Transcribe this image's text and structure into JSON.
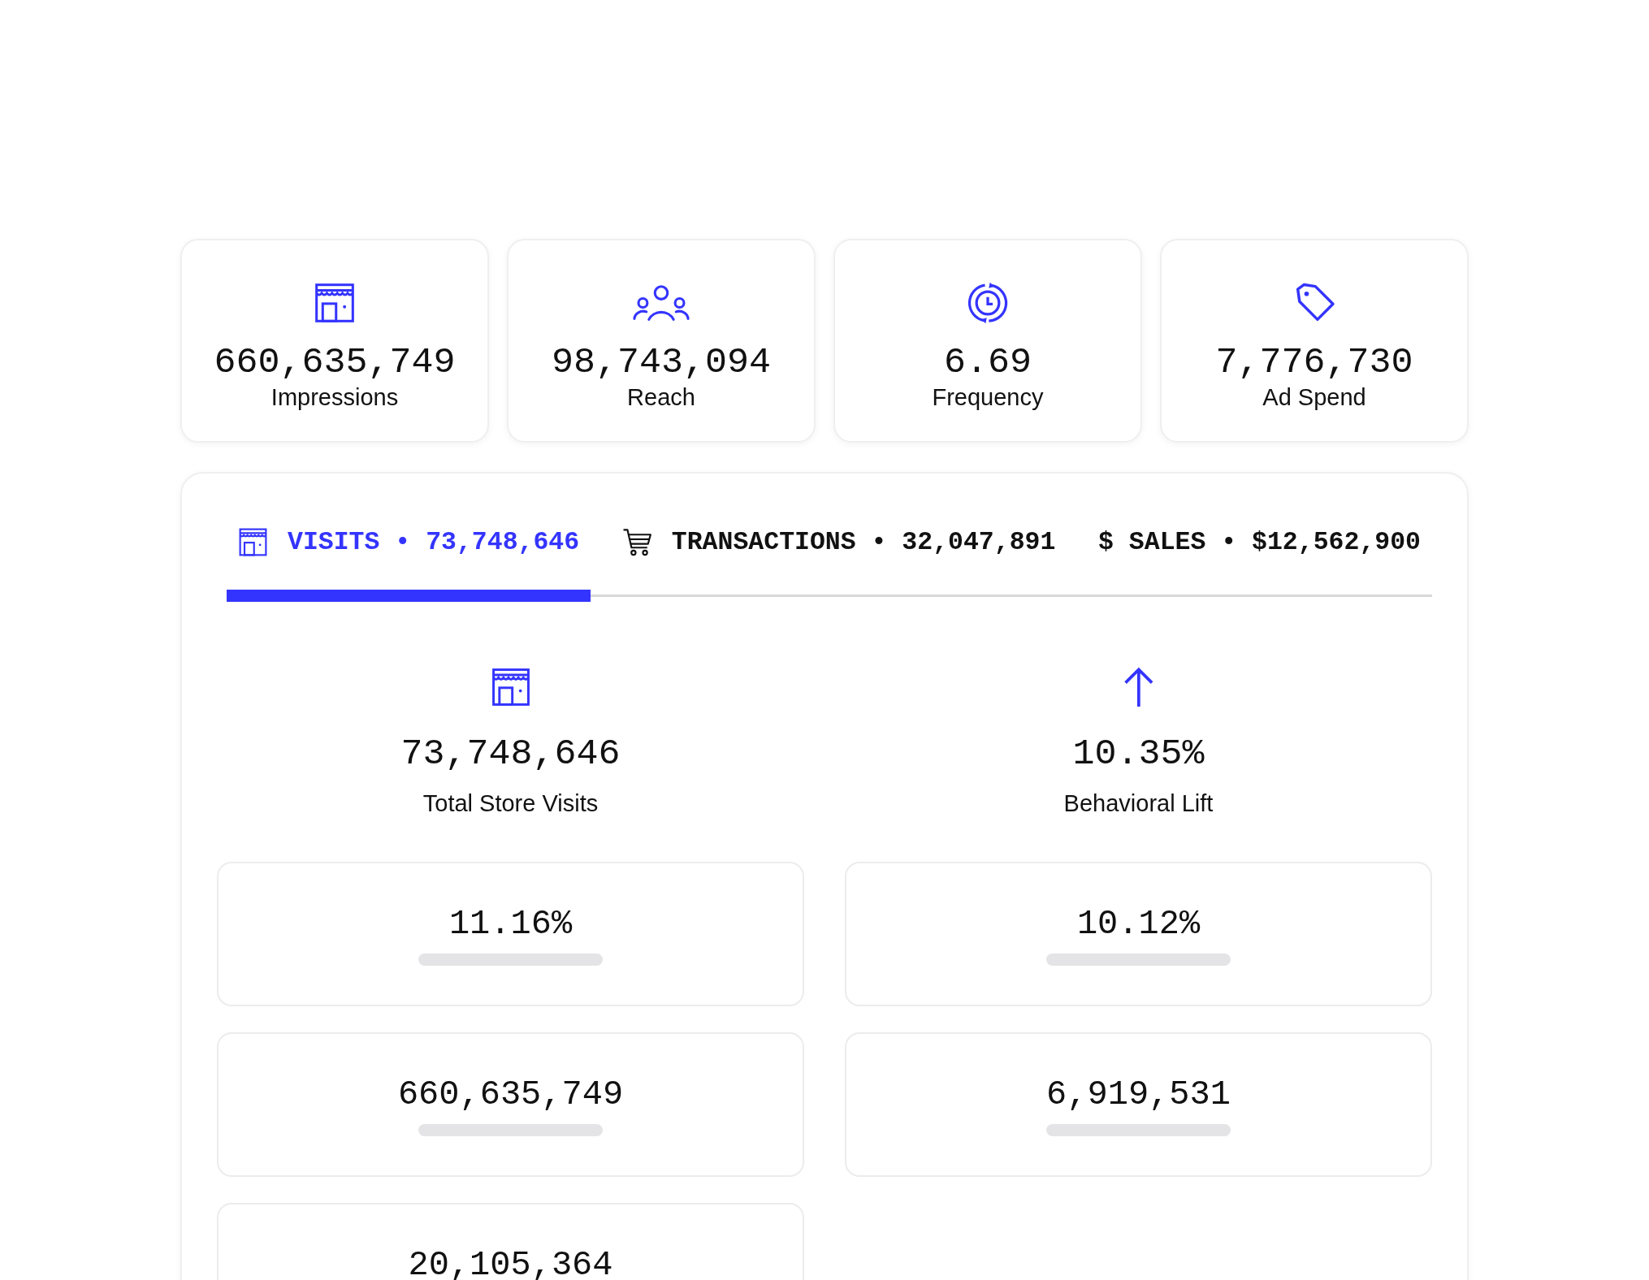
{
  "summary_cards": [
    {
      "value": "660,635,749",
      "label": "Impressions"
    },
    {
      "value": "98,743,094",
      "label": "Reach"
    },
    {
      "value": "6.69",
      "label": "Frequency"
    },
    {
      "value": "7,776,730",
      "label": "Ad Spend"
    }
  ],
  "panel": {
    "tabs": [
      {
        "label": "VISITS • 73,748,646",
        "selected": true
      },
      {
        "label": "TRANSACTIONS • 32,047,891",
        "selected": false
      },
      {
        "label": "$ SALES • $12,562,900",
        "selected": false
      }
    ],
    "highlights": [
      {
        "value": "73,748,646",
        "label": "Total Store Visits"
      },
      {
        "value": "10.35%",
        "label": "Behavioral Lift"
      }
    ],
    "metric_values": [
      "11.16%",
      "10.12%",
      "660,635,749",
      "6,919,531",
      "20,105,364"
    ]
  }
}
